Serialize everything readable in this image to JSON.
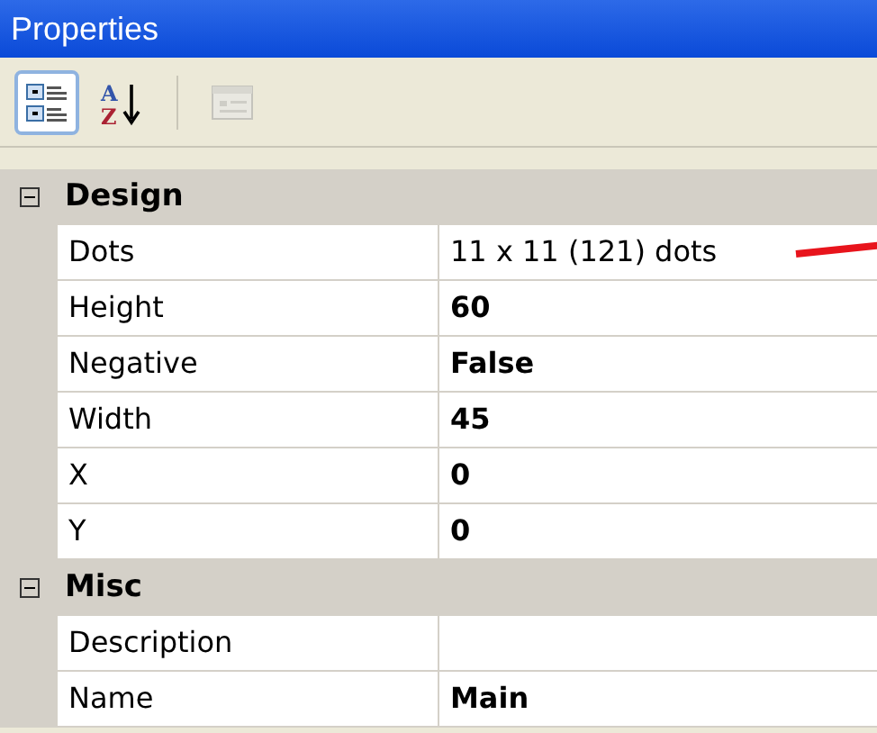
{
  "window": {
    "title": "Properties"
  },
  "toolbar": [
    {
      "kind": "categorized",
      "selected": true,
      "disabled": false
    },
    {
      "kind": "alphabetical",
      "selected": false,
      "disabled": false,
      "letters": [
        "A",
        "Z"
      ]
    },
    {
      "kind": "pages",
      "selected": false,
      "disabled": true
    }
  ],
  "categories": [
    {
      "name": "Design",
      "expanded": true,
      "properties": [
        {
          "name": "Dots",
          "value": "11 x 11 (121) dots",
          "modified": false
        },
        {
          "name": "Height",
          "value": "60",
          "modified": true
        },
        {
          "name": "Negative",
          "value": "False",
          "modified": true
        },
        {
          "name": "Width",
          "value": "45",
          "modified": true
        },
        {
          "name": "X",
          "value": "0",
          "modified": true
        },
        {
          "name": "Y",
          "value": "0",
          "modified": true
        }
      ]
    },
    {
      "name": "Misc",
      "expanded": true,
      "properties": [
        {
          "name": "Description",
          "modified": false
        },
        {
          "name": "Name",
          "value": "Main",
          "modified": true
        }
      ]
    }
  ]
}
